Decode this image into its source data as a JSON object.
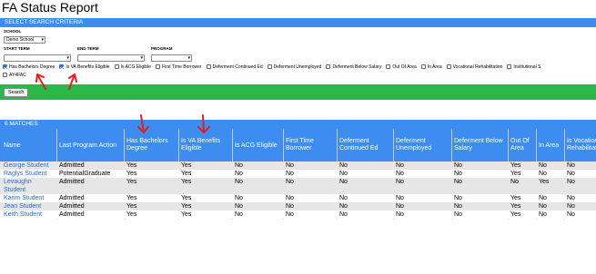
{
  "page": {
    "title": "FA Status Report"
  },
  "criteria": {
    "header": "SELECT SEARCH CRITERIA",
    "school_label": "SCHOOL",
    "school_value": "Demo School",
    "start_term_label": "START TERM",
    "end_term_label": "END TERM",
    "program_label": "PROGRAM",
    "checkboxes": [
      {
        "label": "Has Bachelors Degree",
        "checked": true
      },
      {
        "label": "Is VA Benefits Eligible",
        "checked": true
      },
      {
        "label": "Is ACG Eligible",
        "checked": false
      },
      {
        "label": "First Time Borrower",
        "checked": false
      },
      {
        "label": "Deferment Continued Ed",
        "checked": false
      },
      {
        "label": "Deferment Unemployed",
        "checked": false
      },
      {
        "label": "Deferment Below Salary",
        "checked": false
      },
      {
        "label": "Out Of Area",
        "checked": false
      },
      {
        "label": "In Area",
        "checked": false
      },
      {
        "label": "Vocational Rehabilitation",
        "checked": false
      },
      {
        "label": "Institutional S",
        "checked": false
      },
      {
        "label": "AY4FAC",
        "checked": false
      }
    ],
    "search_button": "Search"
  },
  "results": {
    "header": "6 MATCHES",
    "columns": [
      "Name",
      "Last Program Action",
      "Has Bachelors Degree",
      "Is VA Benefits Eligible",
      "Is ACG Eligible",
      "First Time Borrower",
      "Deferment Continued Ed",
      "Deferment Unemployed",
      "Deferment Below Salary",
      "Out Of Area",
      "In Area",
      "Is Vocation Rehabilitat"
    ],
    "rows": [
      [
        "George Student",
        "Admitted",
        "Yes",
        "Yes",
        "No",
        "No",
        "No",
        "No",
        "No",
        "Yes",
        "No",
        "No"
      ],
      [
        "Raglys Student",
        "PotentialGraduate",
        "Yes",
        "Yes",
        "No",
        "No",
        "No",
        "No",
        "No",
        "Yes",
        "No",
        "No"
      ],
      [
        "Levaughn Student",
        "Admitted",
        "Yes",
        "Yes",
        "No",
        "No",
        "No",
        "No",
        "No",
        "No",
        "Yes",
        "No"
      ],
      [
        "Karim Student",
        "Admitted",
        "Yes",
        "Yes",
        "No",
        "No",
        "No",
        "No",
        "No",
        "Yes",
        "No",
        "No"
      ],
      [
        "Jean Student",
        "Admitted",
        "Yes",
        "Yes",
        "No",
        "No",
        "No",
        "No",
        "No",
        "Yes",
        "No",
        "No"
      ],
      [
        "Keith Student",
        "Admitted",
        "Yes",
        "Yes",
        "No",
        "No",
        "No",
        "No",
        "No",
        "Yes",
        "No",
        "No"
      ]
    ]
  },
  "colors": {
    "header_blue": "#3d8cf0",
    "search_green": "#2ab84a",
    "annotation_red": "#e0201c",
    "link_blue": "#2a6dcf"
  }
}
